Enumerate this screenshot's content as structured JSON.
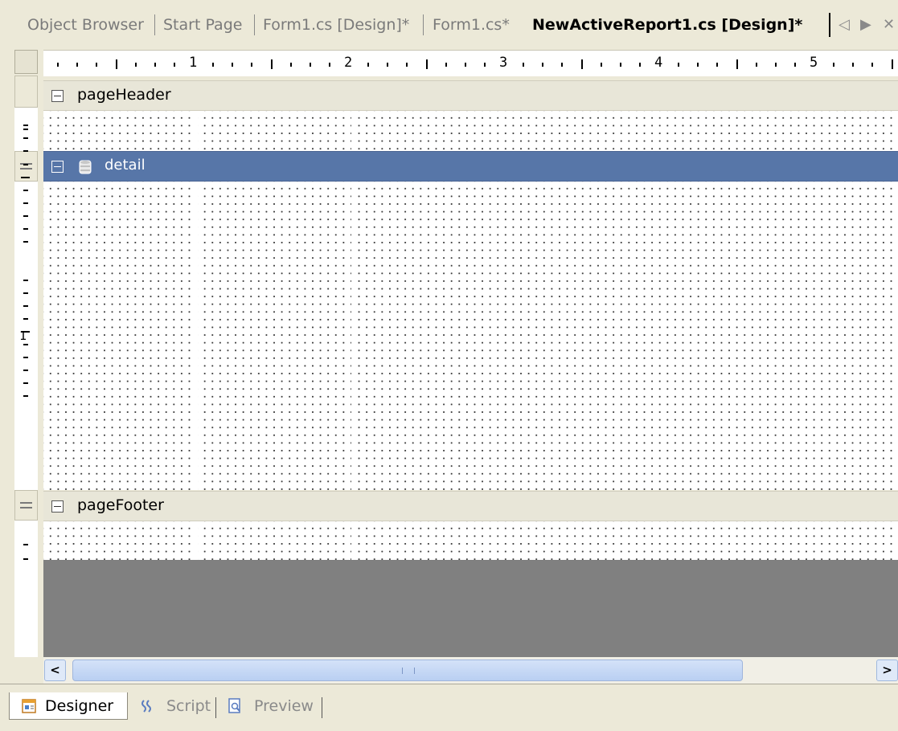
{
  "tabs": {
    "items": [
      {
        "label": "Object Browser"
      },
      {
        "label": "Start Page"
      },
      {
        "label": "Form1.cs [Design]*"
      },
      {
        "label": "Form1.cs*"
      },
      {
        "label": "NewActiveReport1.cs [Design]*",
        "active": true
      }
    ],
    "nav_left": "◁",
    "nav_right": "▶",
    "close": "✕"
  },
  "ruler": {
    "h_numbers": [
      "1",
      "2",
      "3",
      "4",
      "5"
    ],
    "v_number": "1"
  },
  "sections": {
    "page_header": {
      "label": "pageHeader"
    },
    "detail": {
      "label": "detail"
    },
    "page_footer": {
      "label": "pageFooter"
    }
  },
  "scrollbar": {
    "left_arrow": "<",
    "right_arrow": ">"
  },
  "bottom_tabs": {
    "designer": "Designer",
    "script": "Script",
    "preview": "Preview"
  },
  "colors": {
    "selected_section": "#5776a8",
    "empty_canvas": "#808080",
    "chrome": "#ece9d8"
  },
  "icons": {
    "detail": "database-icon",
    "designer": "designer-icon",
    "script": "script-icon",
    "preview": "preview-icon"
  }
}
